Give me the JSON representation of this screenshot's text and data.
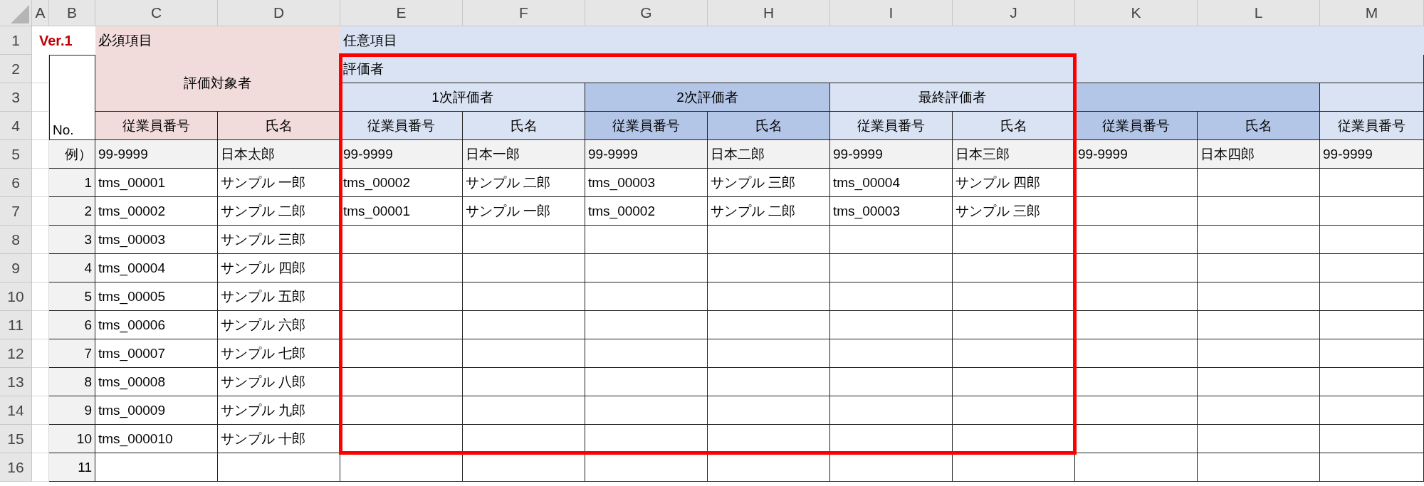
{
  "column_headers": [
    "A",
    "B",
    "C",
    "D",
    "E",
    "F",
    "G",
    "H",
    "I",
    "J",
    "K",
    "L",
    "M"
  ],
  "row_headers": [
    "1",
    "2",
    "3",
    "4",
    "5",
    "6",
    "7",
    "8",
    "9",
    "10",
    "11",
    "12",
    "13",
    "14",
    "15",
    "16"
  ],
  "version": "Ver.1",
  "required_label": "必須項目",
  "optional_label": "任意項目",
  "no_header": "No.",
  "evaluatee_header": "評価対象者",
  "evaluatee_columns": [
    "従業員番号",
    "氏名"
  ],
  "evaluator_header": "評価者",
  "groups": [
    {
      "title": "1次評価者",
      "color": "#dae3f3",
      "columns": [
        "従業員番号",
        "氏名"
      ]
    },
    {
      "title": "2次評価者",
      "color": "#b4c6e7",
      "columns": [
        "従業員番号",
        "氏名"
      ]
    },
    {
      "title": "最終評価者",
      "color": "#dae3f3",
      "columns": [
        "従業員番号",
        "氏名"
      ]
    },
    {
      "color": "#b4c6e7",
      "columns": [
        "従業員番号",
        "氏名"
      ]
    },
    {
      "color": "#dae3f3",
      "columns": [
        "従業員番号"
      ]
    }
  ],
  "example_row": {
    "label": "例）",
    "cells": [
      "99-9999",
      "日本太郎",
      "99-9999",
      "日本一郎",
      "99-9999",
      "日本二郎",
      "99-9999",
      "日本三郎",
      "99-9999",
      "日本四郎",
      "99-9999"
    ]
  },
  "rows": [
    {
      "no": "1",
      "cells": [
        "tms_00001",
        "サンプル 一郎",
        "tms_00002",
        "サンプル 二郎",
        "tms_00003",
        "サンプル 三郎",
        "tms_00004",
        "サンプル 四郎"
      ]
    },
    {
      "no": "2",
      "cells": [
        "tms_00002",
        "サンプル 二郎",
        "tms_00001",
        "サンプル 一郎",
        "tms_00002",
        "サンプル 二郎",
        "tms_00003",
        "サンプル 三郎"
      ]
    },
    {
      "no": "3",
      "cells": [
        "tms_00003",
        "サンプル 三郎"
      ]
    },
    {
      "no": "4",
      "cells": [
        "tms_00004",
        "サンプル 四郎"
      ]
    },
    {
      "no": "5",
      "cells": [
        "tms_00005",
        "サンプル 五郎"
      ]
    },
    {
      "no": "6",
      "cells": [
        "tms_00006",
        "サンプル 六郎"
      ]
    },
    {
      "no": "7",
      "cells": [
        "tms_00007",
        "サンプル 七郎"
      ]
    },
    {
      "no": "8",
      "cells": [
        "tms_00008",
        "サンプル 八郎"
      ]
    },
    {
      "no": "9",
      "cells": [
        "tms_00009",
        "サンプル 九郎"
      ]
    },
    {
      "no": "10",
      "cells": [
        "tms_000010",
        "サンプル 十郎"
      ]
    },
    {
      "no": "11",
      "cells": []
    }
  ]
}
